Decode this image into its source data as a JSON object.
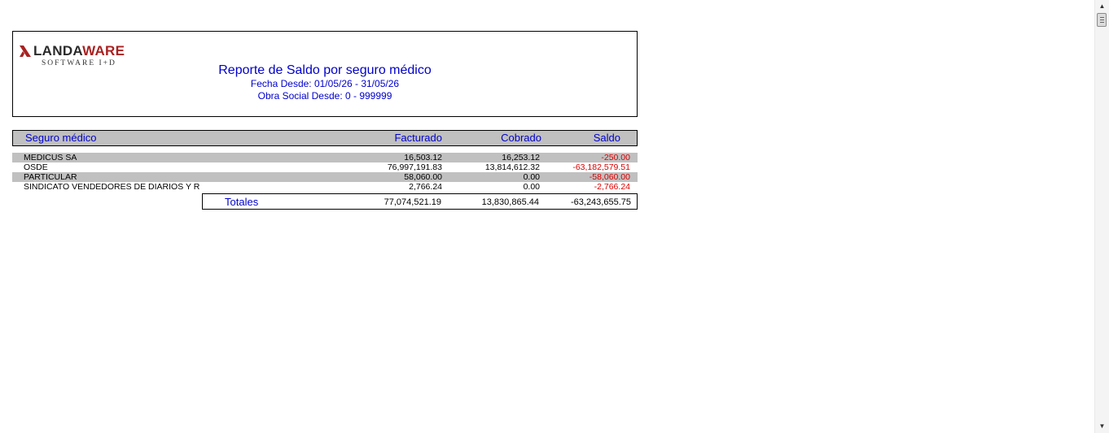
{
  "header": {
    "logo_main": "LANDA",
    "logo_accent": "WARE",
    "logo_sub": "SOFTWARE I+D",
    "title": "Reporte de Saldo por seguro médico",
    "fecha": "Fecha Desde: 01/05/26 - 31/05/26",
    "obra_social": "Obra Social Desde: 0 - 999999"
  },
  "columns": {
    "seguro": "Seguro médico",
    "facturado": "Facturado",
    "cobrado": "Cobrado",
    "saldo": "Saldo"
  },
  "rows": [
    {
      "name": "MEDICUS SA",
      "facturado": "16,503.12",
      "cobrado": "16,253.12",
      "saldo": "-250.00"
    },
    {
      "name": "OSDE",
      "facturado": "76,997,191.83",
      "cobrado": "13,814,612.32",
      "saldo": "-63,182,579.51"
    },
    {
      "name": "PARTICULAR",
      "facturado": "58,060.00",
      "cobrado": "0.00",
      "saldo": "-58,060.00"
    },
    {
      "name": "SINDICATO VENDEDORES DE DIARIOS Y R",
      "facturado": "2,766.24",
      "cobrado": "0.00",
      "saldo": "-2,766.24"
    }
  ],
  "totals": {
    "label": "Totales",
    "facturado": "77,074,521.19",
    "cobrado": "13,830,865.44",
    "saldo": "-63,243,655.75"
  },
  "colors": {
    "accent_blue": "#0000cc",
    "negative_red": "#dd0000",
    "row_shade": "#c0c0c0",
    "logo_red": "#a82222"
  }
}
